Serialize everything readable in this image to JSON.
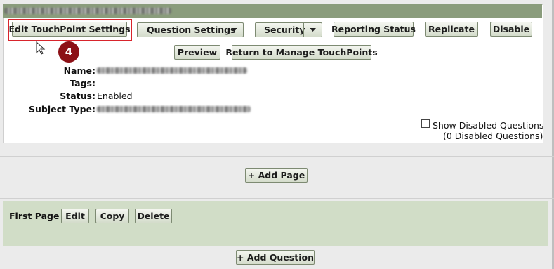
{
  "header": {
    "title_redacted": true
  },
  "toolbar": {
    "edit_settings": "Edit TouchPoint Settings",
    "question_settings": "Question Settings",
    "security": "Security",
    "reporting_status": "Reporting Status",
    "replicate": "Replicate",
    "disable": "Disable",
    "preview": "Preview",
    "return": "Return to Manage TouchPoints"
  },
  "callout": {
    "step": "4"
  },
  "details": {
    "name_label": "Name:",
    "tags_label": "Tags:",
    "status_label": "Status:",
    "status_value": "Enabled",
    "subject_type_label": "Subject Type:"
  },
  "disabled_questions": {
    "checkbox_label": "Show Disabled Questions",
    "count_text": "(0 Disabled Questions)"
  },
  "pages": {
    "add_page": "+ Add Page",
    "first_page_title": "First Page",
    "edit": "Edit",
    "copy": "Copy",
    "delete": "Delete",
    "add_question": "+ Add Question"
  },
  "colors": {
    "title_bar": "#8a9c7c",
    "page_panel": "#d1ddc7",
    "highlight": "#d8242c",
    "badge": "#8c1016"
  }
}
